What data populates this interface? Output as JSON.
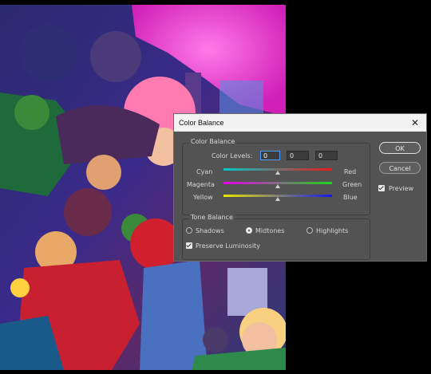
{
  "dialog": {
    "title": "Color Balance",
    "close_glyph": "✕",
    "color_balance_group": "Color Balance",
    "color_levels_label": "Color Levels:",
    "levels": [
      "0",
      "0",
      "0"
    ],
    "sliders": [
      {
        "left": "Cyan",
        "right": "Red",
        "value": 0,
        "gradient": [
          "#00c8c8",
          "#e81818"
        ]
      },
      {
        "left": "Magenta",
        "right": "Green",
        "value": 0,
        "gradient": [
          "#e800e8",
          "#18d818"
        ]
      },
      {
        "left": "Yellow",
        "right": "Blue",
        "value": 0,
        "gradient": [
          "#e8e800",
          "#1818e8"
        ]
      }
    ],
    "tone_balance_group": "Tone Balance",
    "tones": [
      "Shadows",
      "Midtones",
      "Highlights"
    ],
    "selected_tone": "Midtones",
    "preserve_luminosity": "Preserve Luminosity",
    "ok": "OK",
    "cancel": "Cancel",
    "preview": "Preview"
  }
}
